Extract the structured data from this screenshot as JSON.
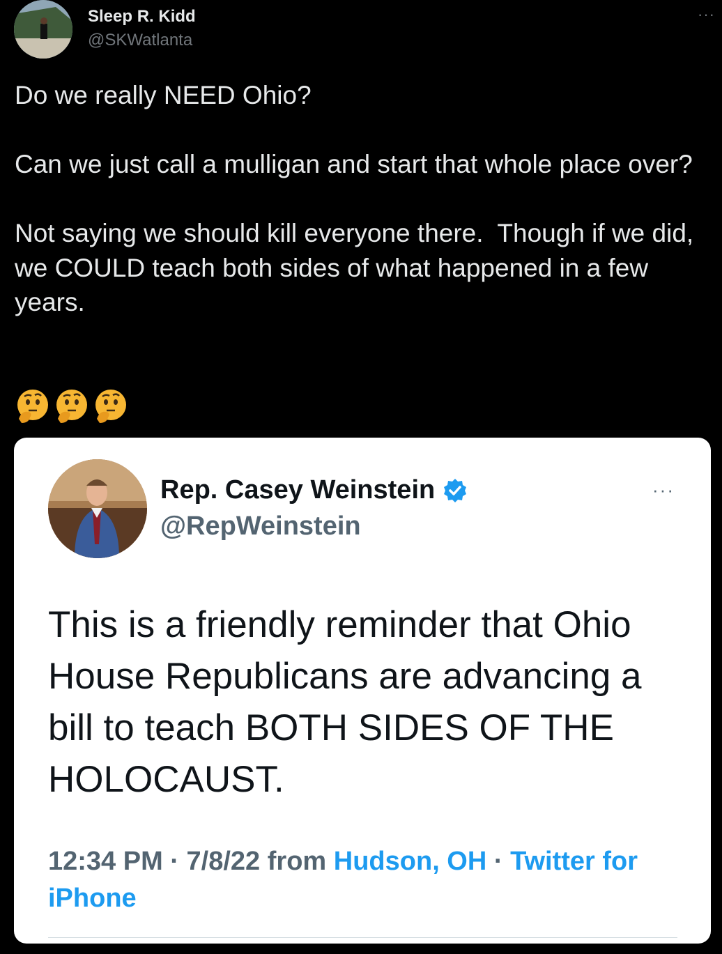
{
  "tweet": {
    "author_name": "Sleep R. Kidd",
    "author_handle": "@SKWatlanta",
    "more_label": "···",
    "text": "Do we really NEED Ohio?\n\nCan we just call a mulligan and start that whole place over?\n\nNot saying we should kill everyone there.  Though if we did, we COULD teach both sides of what happened in a few years.",
    "emojis": [
      "thinking-face-icon",
      "thinking-face-icon",
      "thinking-face-icon"
    ]
  },
  "quoted": {
    "author_name": "Rep. Casey Weinstein",
    "author_handle": "@RepWeinstein",
    "more_label": "···",
    "text": "This is a friendly reminder that Ohio House Republicans are advancing a bill to teach BOTH SIDES OF THE HOLOCAUST.",
    "time": "12:34 PM",
    "date": "7/8/22",
    "from_word": "from",
    "location": "Hudson, OH",
    "separator": " · ",
    "source": "Twitter for iPhone"
  },
  "colors": {
    "background": "#000000",
    "card": "#ffffff",
    "link": "#1d9bf0",
    "verified": "#1d9bf0"
  }
}
